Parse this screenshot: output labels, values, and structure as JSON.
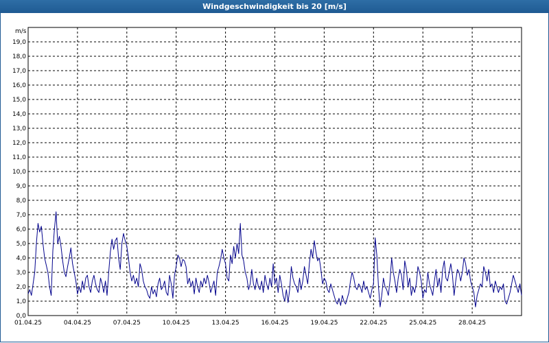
{
  "window": {
    "title": "Windgeschwindigkeit bis 20 [m/s]"
  },
  "chart_data": {
    "type": "line",
    "title": "Windgeschwindigkeit bis 20 [m/s]",
    "ylabel": "m/s",
    "xlabel": "",
    "ylim": [
      0,
      20
    ],
    "y_ticks": [
      "0,0",
      "1,0",
      "2,0",
      "3,0",
      "4,0",
      "5,0",
      "6,0",
      "7,0",
      "8,0",
      "9,0",
      "10,0",
      "11,0",
      "12,0",
      "13,0",
      "14,0",
      "15,0",
      "16,0",
      "17,0",
      "18,0",
      "19,0"
    ],
    "x_ticks": [
      "01.04.25",
      "04.04.25",
      "07.04.25",
      "10.04.25",
      "13.04.25",
      "16.04.25",
      "19.04.25",
      "22.04.25",
      "25.04.25",
      "28.04.25"
    ],
    "x_tick_days": [
      0,
      3,
      6,
      9,
      12,
      15,
      18,
      21,
      24,
      27
    ],
    "xlim_days": [
      0,
      30
    ],
    "grid": true,
    "series": [
      {
        "color": "#00008b",
        "x_days": [
          0,
          0.1,
          0.2,
          0.3,
          0.4,
          0.5,
          0.6,
          0.7,
          0.8,
          0.9,
          1.0,
          1.1,
          1.2,
          1.3,
          1.4,
          1.5,
          1.6,
          1.7,
          1.8,
          1.9,
          2.0,
          2.1,
          2.2,
          2.3,
          2.4,
          2.5,
          2.6,
          2.7,
          2.8,
          2.9,
          3.0,
          3.1,
          3.2,
          3.3,
          3.4,
          3.5,
          3.6,
          3.7,
          3.8,
          3.9,
          4.0,
          4.1,
          4.2,
          4.3,
          4.4,
          4.5,
          4.6,
          4.7,
          4.8,
          4.9,
          5.0,
          5.1,
          5.2,
          5.3,
          5.4,
          5.5,
          5.6,
          5.7,
          5.8,
          5.9,
          6.0,
          6.1,
          6.2,
          6.3,
          6.4,
          6.5,
          6.6,
          6.7,
          6.8,
          6.9,
          7.0,
          7.1,
          7.2,
          7.3,
          7.4,
          7.5,
          7.6,
          7.7,
          7.8,
          7.9,
          8.0,
          8.1,
          8.2,
          8.3,
          8.4,
          8.5,
          8.6,
          8.7,
          8.8,
          8.9,
          9.0,
          9.1,
          9.2,
          9.3,
          9.4,
          9.5,
          9.6,
          9.7,
          9.8,
          9.9,
          10.0,
          10.1,
          10.2,
          10.3,
          10.4,
          10.5,
          10.6,
          10.7,
          10.8,
          10.9,
          11.0,
          11.1,
          11.2,
          11.3,
          11.4,
          11.5,
          11.6,
          11.7,
          11.8,
          11.9,
          12.0,
          12.1,
          12.2,
          12.3,
          12.4,
          12.5,
          12.6,
          12.7,
          12.8,
          12.9,
          13.0,
          13.1,
          13.2,
          13.3,
          13.4,
          13.5,
          13.6,
          13.7,
          13.8,
          13.9,
          14.0,
          14.1,
          14.2,
          14.3,
          14.4,
          14.5,
          14.6,
          14.7,
          14.8,
          14.9,
          15.0,
          15.1,
          15.2,
          15.3,
          15.4,
          15.5,
          15.6,
          15.7,
          15.8,
          15.9,
          16.0,
          16.1,
          16.2,
          16.3,
          16.4,
          16.5,
          16.6,
          16.7,
          16.8,
          16.9,
          17.0,
          17.1,
          17.2,
          17.3,
          17.4,
          17.5,
          17.6,
          17.7,
          17.8,
          17.9,
          18.0,
          18.1,
          18.2,
          18.3,
          18.4,
          18.5,
          18.6,
          18.7,
          18.8,
          18.9,
          19.0,
          19.1,
          19.2,
          19.3,
          19.4,
          19.5,
          19.6,
          19.7,
          19.8,
          19.9,
          20.0,
          20.1,
          20.2,
          20.3,
          20.4,
          20.5,
          20.6,
          20.7,
          20.8,
          20.9,
          21.0,
          21.1,
          21.2,
          21.3,
          21.4,
          21.5,
          21.6,
          21.7,
          21.8,
          21.9,
          22.0,
          22.1,
          22.2,
          22.3,
          22.4,
          22.5,
          22.6,
          22.7,
          22.8,
          22.9,
          23.0,
          23.1,
          23.2,
          23.3,
          23.4,
          23.5,
          23.6,
          23.7,
          23.8,
          23.9,
          24.0,
          24.1,
          24.2,
          24.3,
          24.4,
          24.5,
          24.6,
          24.7,
          24.8,
          24.9,
          25.0,
          25.1,
          25.2,
          25.3,
          25.4,
          25.5,
          25.6,
          25.7,
          25.8,
          25.9,
          26.0,
          26.1,
          26.2,
          26.3,
          26.4,
          26.5,
          26.6,
          26.7,
          26.8,
          26.9,
          27.0,
          27.1,
          27.2,
          27.3,
          27.4,
          27.5,
          27.6,
          27.7,
          27.8,
          27.9,
          28.0,
          28.1,
          28.2,
          28.3,
          28.4,
          28.5,
          28.6,
          28.7,
          28.8,
          28.9,
          29.0,
          29.1,
          29.2,
          29.3,
          29.4,
          29.5,
          29.6,
          29.7,
          29.8,
          29.9,
          30.0
        ],
        "values": [
          1.5,
          1.8,
          1.4,
          2.2,
          3.0,
          5.0,
          6.4,
          5.8,
          6.2,
          5.0,
          4.0,
          3.5,
          3.0,
          2.0,
          1.4,
          4.5,
          6.0,
          7.2,
          5.0,
          5.5,
          4.8,
          3.8,
          3.0,
          2.7,
          3.4,
          4.0,
          4.7,
          3.6,
          3.0,
          2.4,
          1.5,
          2.0,
          1.6,
          2.4,
          1.8,
          2.6,
          2.8,
          2.0,
          1.6,
          2.4,
          2.8,
          2.2,
          1.8,
          1.6,
          2.6,
          2.2,
          1.6,
          2.4,
          1.4,
          3.0,
          4.4,
          5.3,
          4.6,
          5.2,
          5.4,
          4.0,
          3.2,
          5.0,
          5.7,
          5.2,
          4.8,
          4.0,
          3.0,
          2.4,
          2.8,
          2.2,
          2.6,
          2.0,
          3.6,
          3.2,
          2.4,
          2.0,
          1.8,
          1.4,
          1.2,
          2.0,
          1.5,
          1.8,
          1.3,
          2.2,
          2.6,
          1.8,
          2.0,
          2.4,
          1.6,
          1.4,
          2.8,
          2.2,
          1.2,
          2.8,
          3.4,
          4.2,
          4.0,
          3.4,
          3.9,
          3.8,
          3.4,
          2.2,
          2.6,
          2.0,
          2.4,
          1.5,
          2.6,
          2.0,
          1.6,
          2.4,
          2.0,
          2.6,
          2.2,
          2.8,
          2.3,
          1.6,
          2.0,
          2.4,
          1.4,
          3.0,
          3.4,
          3.9,
          4.6,
          4.0,
          3.6,
          2.6,
          2.4,
          4.2,
          3.6,
          4.8,
          4.0,
          5.0,
          4.3,
          6.4,
          4.2,
          3.8,
          3.0,
          2.6,
          1.8,
          2.2,
          3.2,
          2.2,
          1.8,
          2.6,
          2.0,
          1.8,
          2.4,
          1.6,
          2.8,
          2.2,
          1.8,
          2.6,
          2.0,
          3.6,
          2.2,
          2.6,
          1.6,
          2.8,
          2.2,
          1.4,
          1.0,
          1.8,
          0.9,
          1.8,
          3.4,
          2.6,
          2.2,
          2.0,
          1.6,
          2.6,
          1.8,
          2.4,
          3.4,
          2.8,
          2.2,
          3.6,
          4.6,
          4.0,
          5.2,
          4.4,
          3.8,
          4.0,
          3.2,
          2.2,
          2.6,
          2.4,
          1.8,
          1.6,
          2.2,
          1.8,
          1.4,
          1.0,
          0.8,
          1.2,
          0.7,
          1.4,
          1.0,
          0.8,
          1.2,
          1.6,
          2.4,
          3.0,
          2.6,
          2.0,
          1.8,
          2.2,
          2.0,
          1.6,
          2.4,
          1.8,
          2.0,
          1.6,
          1.2,
          1.8,
          2.2,
          5.4,
          4.2,
          2.0,
          0.6,
          1.4,
          2.6,
          2.0,
          1.8,
          1.4,
          2.4,
          4.0,
          3.0,
          2.4,
          1.6,
          2.6,
          3.2,
          2.8,
          1.8,
          3.8,
          3.2,
          2.0,
          2.6,
          1.4,
          2.0,
          1.6,
          2.2,
          3.4,
          3.0,
          2.4,
          1.2,
          1.8,
          1.6,
          3.0,
          2.2,
          1.8,
          1.4,
          2.4,
          3.2,
          2.0,
          2.6,
          1.6,
          3.2,
          3.8,
          2.6,
          2.4,
          3.0,
          3.6,
          2.8,
          1.4,
          2.4,
          3.2,
          3.0,
          2.4,
          3.0,
          4.0,
          3.6,
          2.8,
          3.2,
          2.4,
          2.0,
          1.6,
          0.6,
          1.4,
          1.8,
          2.2,
          2.0,
          3.4,
          3.0,
          2.4,
          3.2,
          2.0,
          2.2,
          1.6,
          2.4,
          2.0,
          1.6,
          2.0,
          1.8,
          2.2,
          1.0,
          0.8,
          1.2,
          1.6,
          2.2,
          2.8,
          2.4,
          2.0,
          1.6,
          2.2,
          1.4,
          1.0,
          2.0,
          1.8,
          2.4,
          2.0,
          1.4,
          1.0,
          1.6,
          2.4,
          1.8,
          1.2,
          1.8,
          2.4,
          2.0,
          1.6,
          2.0,
          2.2,
          1.8,
          2.4,
          2.0,
          2.6,
          1.6,
          2.2
        ]
      }
    ]
  }
}
